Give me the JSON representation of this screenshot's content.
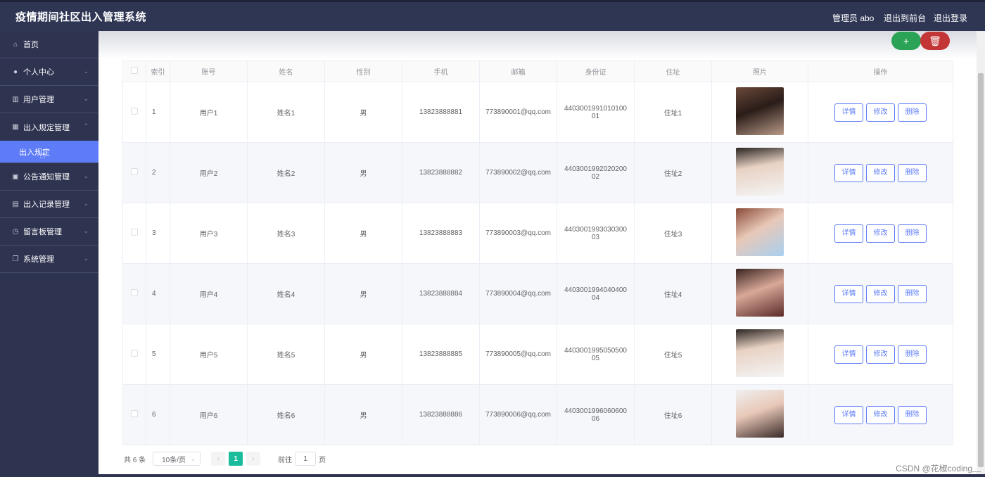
{
  "app": {
    "title": "疫情期间社区出入管理系统"
  },
  "header": {
    "admin": "管理员 abo",
    "front": "退出到前台",
    "logout": "退出登录"
  },
  "sidebar": {
    "items": [
      {
        "label": "首页",
        "icon": "home-icon"
      },
      {
        "label": "个人中心",
        "icon": "user-icon"
      },
      {
        "label": "用户管理",
        "icon": "chart-icon"
      },
      {
        "label": "出入规定管理",
        "icon": "grid-icon"
      },
      {
        "label": "出入规定",
        "icon": ""
      },
      {
        "label": "公告通知管理",
        "icon": "notice-icon"
      },
      {
        "label": "出入记录管理",
        "icon": "record-icon"
      },
      {
        "label": "留言板管理",
        "icon": "compass-icon"
      },
      {
        "label": "系统管理",
        "icon": "copy-icon"
      }
    ]
  },
  "toolbar": {
    "add": "+",
    "delete": "🗑"
  },
  "table": {
    "headers": [
      "索引",
      "账号",
      "姓名",
      "性别",
      "手机",
      "邮箱",
      "身份证",
      "住址",
      "照片",
      "操作"
    ],
    "rows": [
      {
        "idx": "1",
        "account": "用户1",
        "name": "姓名1",
        "sex": "男",
        "phone": "13823888881",
        "email": "773890001@qq.com",
        "id1": "4403001991010100",
        "id2": "01",
        "addr": "住址1"
      },
      {
        "idx": "2",
        "account": "用户2",
        "name": "姓名2",
        "sex": "男",
        "phone": "13823888882",
        "email": "773890002@qq.com",
        "id1": "4403001992020200",
        "id2": "02",
        "addr": "住址2"
      },
      {
        "idx": "3",
        "account": "用户3",
        "name": "姓名3",
        "sex": "男",
        "phone": "13823888883",
        "email": "773890003@qq.com",
        "id1": "4403001993030300",
        "id2": "03",
        "addr": "住址3"
      },
      {
        "idx": "4",
        "account": "用户4",
        "name": "姓名4",
        "sex": "男",
        "phone": "13823888884",
        "email": "773890004@qq.com",
        "id1": "4403001994040400",
        "id2": "04",
        "addr": "住址4"
      },
      {
        "idx": "5",
        "account": "用户5",
        "name": "姓名5",
        "sex": "男",
        "phone": "13823888885",
        "email": "773890005@qq.com",
        "id1": "4403001995050500",
        "id2": "05",
        "addr": "住址5"
      },
      {
        "idx": "6",
        "account": "用户6",
        "name": "姓名6",
        "sex": "男",
        "phone": "13823888886",
        "email": "773890006@qq.com",
        "id1": "4403001996060600",
        "id2": "06",
        "addr": "住址6"
      }
    ],
    "actions": {
      "detail": "详情",
      "edit": "修改",
      "delete": "删除"
    }
  },
  "pagination": {
    "total": "共 6 条",
    "page_size": "10条/页",
    "prev": "‹",
    "current": "1",
    "next": "›",
    "goto_prefix": "前往",
    "goto_value": "1",
    "goto_suffix": "页"
  },
  "watermark": "CSDN @花椒coding﹏"
}
